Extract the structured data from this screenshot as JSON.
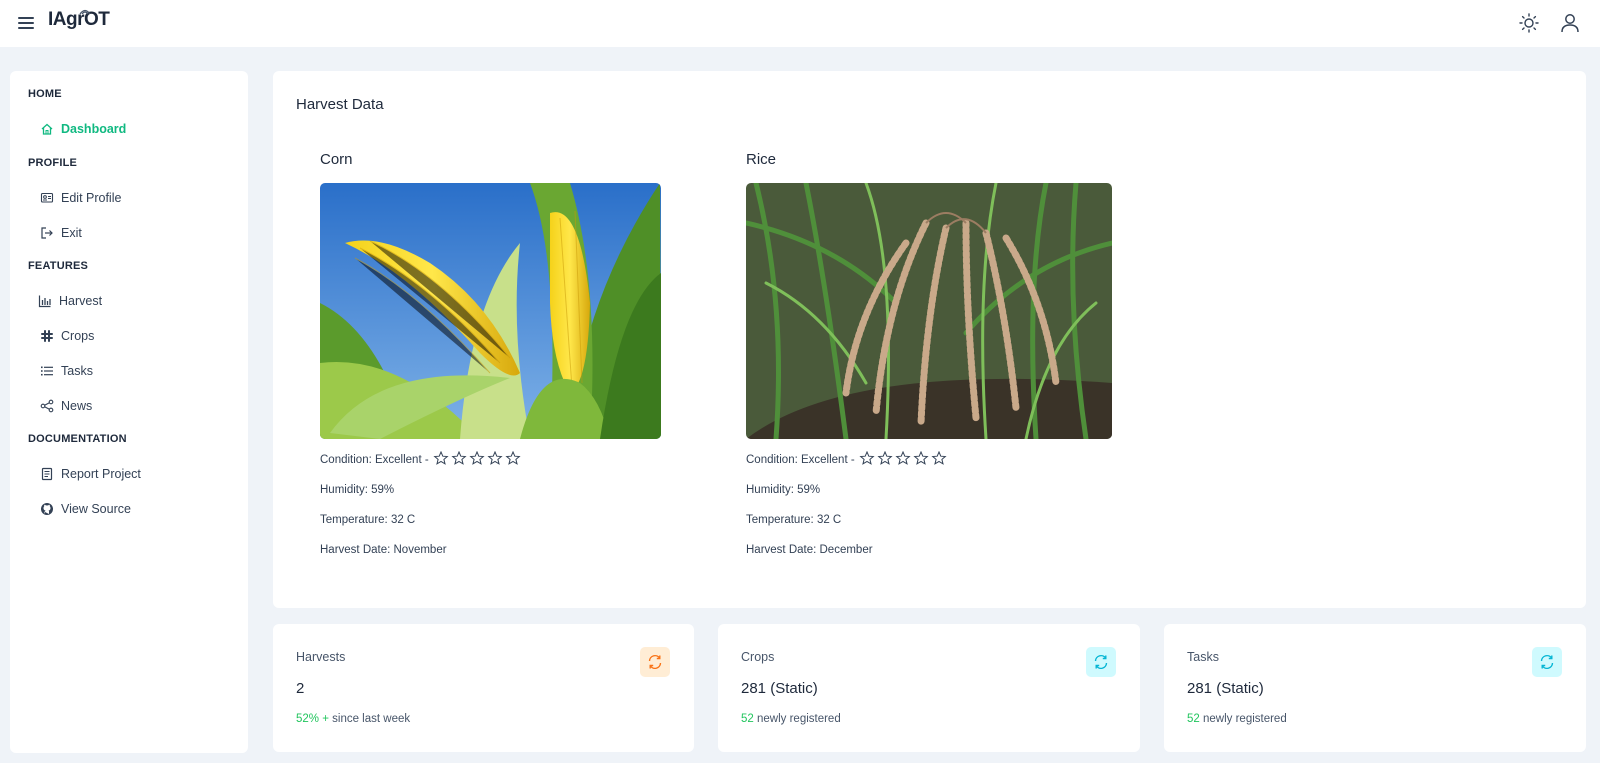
{
  "app": {
    "logo": "IAgrOT"
  },
  "sidebar": {
    "sections": [
      {
        "label": "HOME"
      },
      {
        "label": "PROFILE"
      },
      {
        "label": "FEATURES"
      },
      {
        "label": "DOCUMENTATION"
      }
    ],
    "items": [
      {
        "label": "Dashboard",
        "icon": "home-icon"
      },
      {
        "label": "Edit Profile",
        "icon": "id-card-icon"
      },
      {
        "label": "Exit",
        "icon": "sign-out-icon"
      },
      {
        "label": "Harvest",
        "icon": "chart-bar-icon"
      },
      {
        "label": "Crops",
        "icon": "slack-icon"
      },
      {
        "label": "Tasks",
        "icon": "list-icon"
      },
      {
        "label": "News",
        "icon": "share-icon"
      },
      {
        "label": "Report Project",
        "icon": "book-icon"
      },
      {
        "label": "View Source",
        "icon": "github-icon"
      }
    ]
  },
  "main": {
    "title": "Harvest Data",
    "crops": [
      {
        "name": "Corn",
        "condition": "Condition: Excellent -",
        "humidity": "Humidity: 59%",
        "temperature": "Temperature: 32 C",
        "harvest_date": "Harvest Date: November"
      },
      {
        "name": "Rice",
        "condition": "Condition: Excellent -",
        "humidity": "Humidity: 59%",
        "temperature": "Temperature: 32 C",
        "harvest_date": "Harvest Date: December"
      }
    ]
  },
  "stats": [
    {
      "label": "Harvests",
      "value": "2",
      "highlight": "52% +",
      "foot": " since last week",
      "accent": "#f97316",
      "bg": "#ffedd5"
    },
    {
      "label": "Crops",
      "value": "281 (Static)",
      "highlight": "52",
      "foot": " newly registered",
      "accent": "#06b6d4",
      "bg": "#cffafe"
    },
    {
      "label": "Tasks",
      "value": "281 (Static)",
      "highlight": "52",
      "foot": " newly registered",
      "accent": "#06b6d4",
      "bg": "#cffafe"
    }
  ],
  "colors": {
    "accent": "#10b981",
    "background": "#eff3f8"
  }
}
